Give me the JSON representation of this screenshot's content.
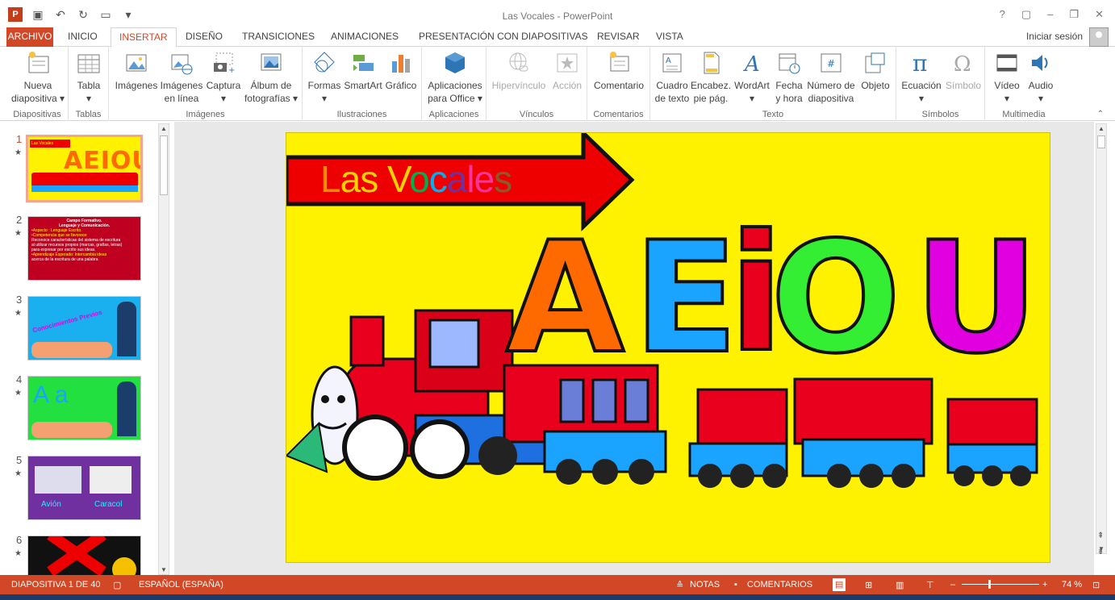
{
  "window": {
    "title": "Las Vocales - PowerPoint",
    "help": "?",
    "ribbon_opts": "▢",
    "minimize": "–",
    "restore": "❐",
    "close": "✕"
  },
  "qat": {
    "logo": "P",
    "save_icon": "save-icon",
    "undo_icon": "undo-icon",
    "redo_icon": "redo-icon",
    "start_icon": "from-beginning-icon",
    "more": "▾"
  },
  "tabs": [
    "ARCHIVO",
    "INICIO",
    "INSERTAR",
    "DISEÑO",
    "TRANSICIONES",
    "ANIMACIONES",
    "PRESENTACIÓN CON DIAPOSITIVAS",
    "REVISAR",
    "VISTA"
  ],
  "active_tab": "INSERTAR",
  "signin": "Iniciar sesión",
  "ribbon": {
    "groups": {
      "diapositivas": "Diapositivas",
      "tablas": "Tablas",
      "imagenes": "Imágenes",
      "ilustraciones": "Ilustraciones",
      "aplicaciones": "Aplicaciones",
      "vinculos": "Vínculos",
      "comentarios": "Comentarios",
      "texto": "Texto",
      "simbolos": "Símbolos",
      "multimedia": "Multimedia"
    },
    "buttons": {
      "nueva": [
        "Nueva",
        "diapositiva ▾"
      ],
      "tabla": [
        "Tabla",
        "▾"
      ],
      "imagenes": [
        "Imágenes",
        ""
      ],
      "imagenes_linea": [
        "Imágenes",
        "en línea"
      ],
      "captura": [
        "Captura",
        "▾"
      ],
      "album": [
        "Álbum de",
        "fotografías ▾"
      ],
      "formas": [
        "Formas",
        "▾"
      ],
      "smartart": [
        "SmartArt",
        ""
      ],
      "grafico": [
        "Gráfico",
        ""
      ],
      "apps": [
        "Aplicaciones",
        "para Office ▾"
      ],
      "hipervinculo": [
        "Hipervínculo",
        ""
      ],
      "accion": [
        "Acción",
        ""
      ],
      "comentario": [
        "Comentario",
        ""
      ],
      "cuadro": [
        "Cuadro",
        "de texto"
      ],
      "encabez": [
        "Encabez.",
        "pie pág."
      ],
      "wordart": [
        "WordArt",
        "▾"
      ],
      "fecha": [
        "Fecha",
        "y hora"
      ],
      "numero": [
        "Número de",
        "diapositiva"
      ],
      "objeto": [
        "Objeto",
        ""
      ],
      "ecuacion": [
        "Ecuación",
        "▾"
      ],
      "simbolo": [
        "Símbolo",
        ""
      ],
      "video": [
        "Vídeo",
        "▾"
      ],
      "audio": [
        "Audio",
        "▾"
      ]
    },
    "collapse": "⌃"
  },
  "thumbnails": [
    {
      "num": "1",
      "star": "★",
      "caption": "Las Vocales",
      "letters": "AEIOU"
    },
    {
      "num": "2",
      "star": "★",
      "title": "Campo Formativo.",
      "subtitle": "Lenguaje y Comunicación.",
      "lines": [
        "•Aspecto : Lenguaje Escrito.",
        "•Competencia que se favorece:",
        "Reconoce características del sistema de escritura",
        "al utilizar recursos propios (marcas, grafías, letras)",
        "para expresar por escrito sus ideas.",
        "•Aprendizaje Esperado: Intercambia ideas",
        "acerca de la escritura de una palabra"
      ]
    },
    {
      "num": "3",
      "star": "★",
      "caption": "Conocimientos Previos"
    },
    {
      "num": "4",
      "star": "★",
      "letters": "A a"
    },
    {
      "num": "5",
      "star": "★",
      "labels": [
        "Avión",
        "Caracol"
      ]
    },
    {
      "num": "6",
      "star": "★"
    }
  ],
  "slide": {
    "title_letters": [
      "L",
      "a",
      "s",
      " ",
      "V",
      "o",
      "c",
      "a",
      "l",
      "e",
      "s"
    ],
    "title_colors": [
      "#ff8c00",
      "#ffd200",
      "#ffd200",
      "#ffffff",
      "#ffd200",
      "#00b050",
      "#00b0f0",
      "#7030a0",
      "#ff3399",
      "#ff3399",
      "#8b5a2b"
    ],
    "vowels": [
      {
        "letter": "A",
        "color": "#ff6a00"
      },
      {
        "letter": "E",
        "color": "#1aa3ff"
      },
      {
        "letter": "i",
        "color": "#e8001c"
      },
      {
        "letter": "O",
        "color": "#33ee33"
      },
      {
        "letter": "U",
        "color": "#e000e0"
      }
    ]
  },
  "status": {
    "slide": "DIAPOSITIVA 1 DE 40",
    "language": "ESPAÑOL (ESPAÑA)",
    "notes": "NOTAS",
    "comments": "COMENTARIOS",
    "zoom": "74 %",
    "minus": "–",
    "plus": "+"
  }
}
